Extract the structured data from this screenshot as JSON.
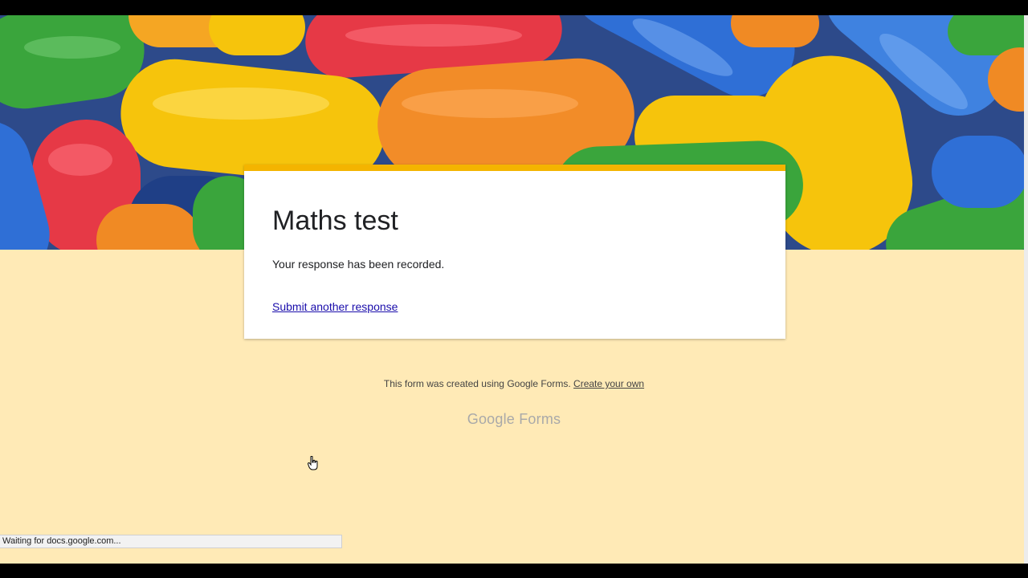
{
  "form": {
    "title": "Maths test",
    "confirmation": "Your response has been recorded.",
    "submit_another": "Submit another response",
    "accent_color": "#f4b400",
    "background_color": "#ffeab6"
  },
  "footer": {
    "created_text": "This form was created using Google Forms.",
    "create_link": "Create your own",
    "logo_google": "Google",
    "logo_forms": "Forms"
  },
  "browser": {
    "status_text": "Waiting for docs.google.com..."
  },
  "icons": {
    "cursor": "hand-pointer-icon"
  }
}
